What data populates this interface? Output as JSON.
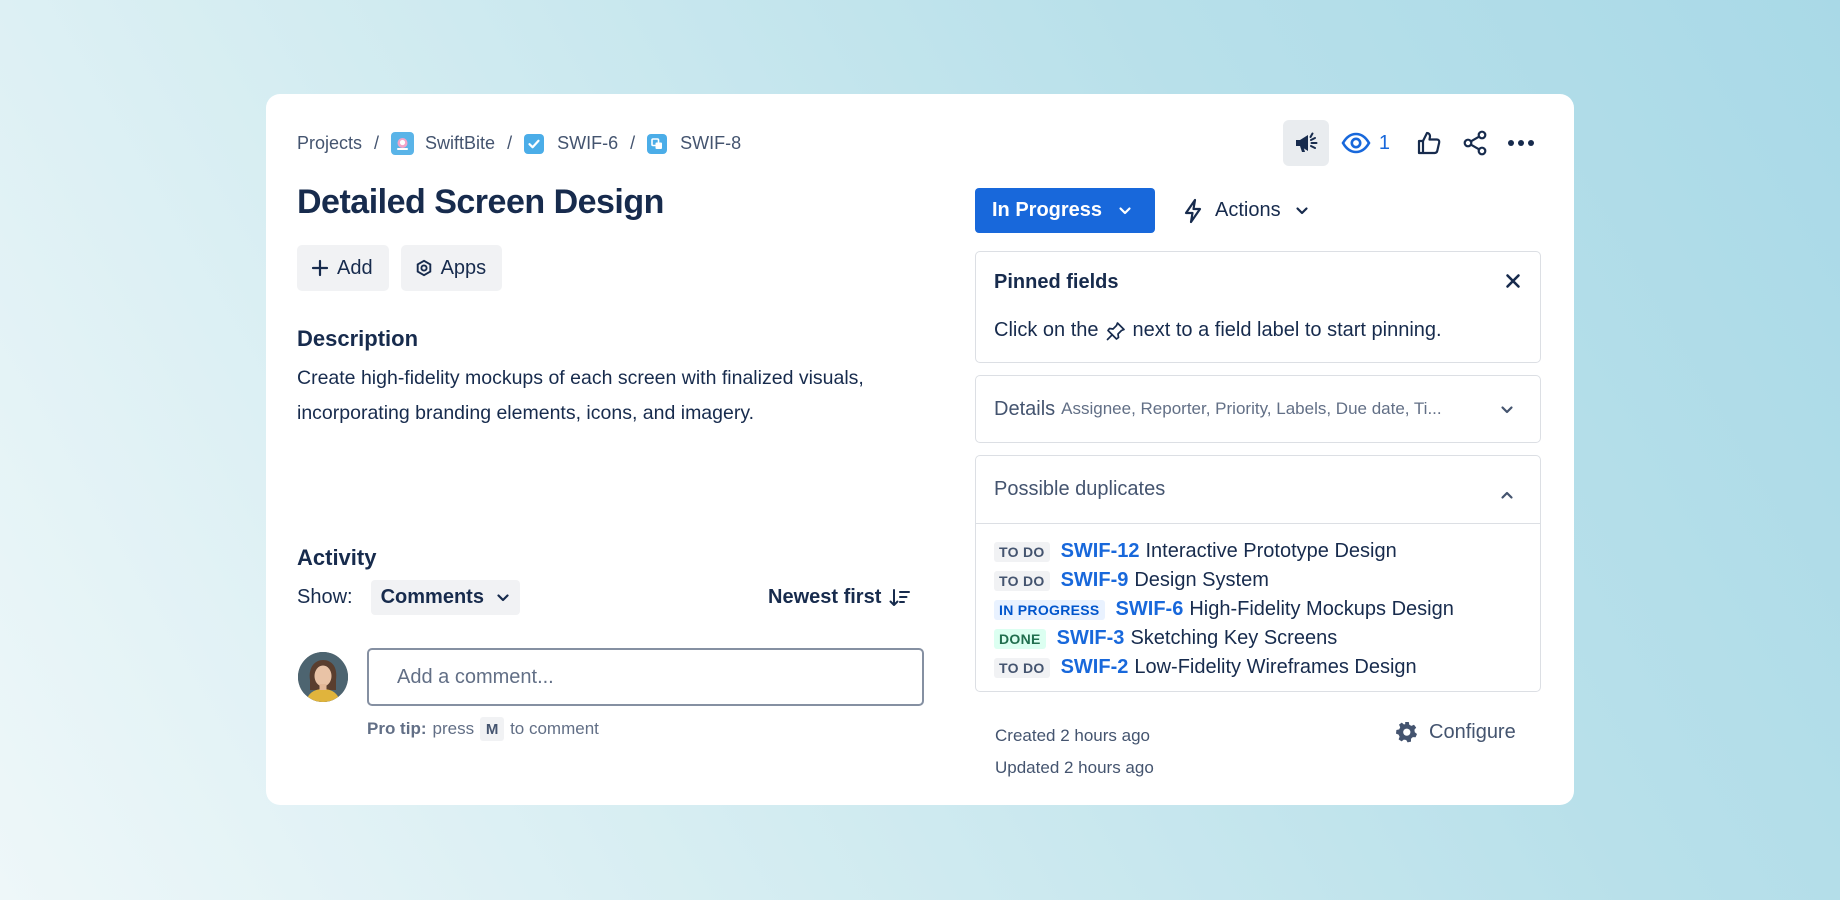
{
  "breadcrumbs": {
    "projects": "Projects",
    "separator": "/",
    "project": "SwiftBite",
    "parent": "SWIF-6",
    "current": "SWIF-8"
  },
  "toolbar": {
    "watch_count": "1"
  },
  "issue": {
    "title": "Detailed Screen Design",
    "add_label": "Add",
    "apps_label": "Apps",
    "description_heading": "Description",
    "description": "Create high-fidelity mockups of each screen with finalized visuals, incorporating branding elements, icons, and imagery."
  },
  "activity": {
    "heading": "Activity",
    "show_label": "Show:",
    "filter_value": "Comments",
    "sort_label": "Newest first",
    "comment_placeholder": "Add a comment...",
    "protip_bold": "Pro tip:",
    "protip_pre": "press",
    "protip_key": "M",
    "protip_post": "to comment"
  },
  "status": {
    "label": "In Progress",
    "color": "#1868db"
  },
  "actions": {
    "label": "Actions"
  },
  "pinned": {
    "heading": "Pinned fields",
    "text_pre": "Click on the",
    "text_post": "next to a field label to start pinning."
  },
  "details": {
    "label": "Details",
    "fields": "Assignee, Reporter, Priority, Labels, Due date, Ti..."
  },
  "duplicates": {
    "heading": "Possible duplicates",
    "items": [
      {
        "status": "TO DO",
        "key": "SWIF-12",
        "summary": "Interactive Prototype Design"
      },
      {
        "status": "TO DO",
        "key": "SWIF-9",
        "summary": "Design System"
      },
      {
        "status": "IN PROGRESS",
        "key": "SWIF-6",
        "summary": "High-Fidelity Mockups Design"
      },
      {
        "status": "DONE",
        "key": "SWIF-3",
        "summary": "Sketching Key Screens"
      },
      {
        "status": "TO DO",
        "key": "SWIF-2",
        "summary": "Low-Fidelity Wireframes Design"
      }
    ],
    "lozenge_colors": {
      "TO DO": {
        "bg": "#f1f2f4",
        "fg": "#44546f"
      },
      "IN PROGRESS": {
        "bg": "#e9f2ff",
        "fg": "#0055cc"
      },
      "DONE": {
        "bg": "#dcfff1",
        "fg": "#216e4e"
      }
    }
  },
  "footer": {
    "created": "Created 2 hours ago",
    "updated": "Updated 2 hours ago",
    "configure": "Configure"
  }
}
